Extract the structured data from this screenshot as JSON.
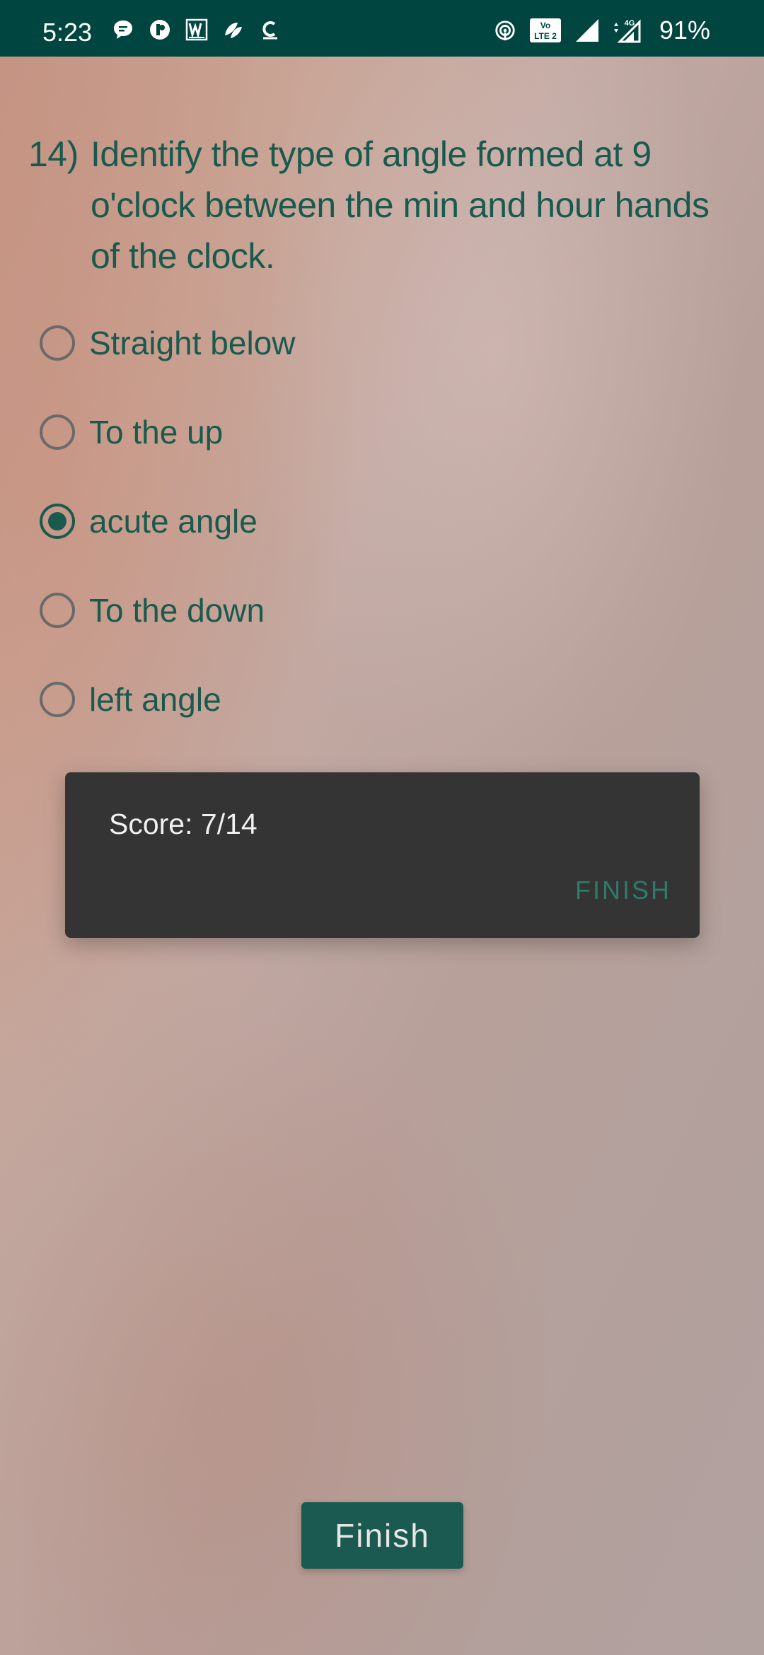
{
  "status_bar": {
    "time": "5:23",
    "battery": "91%",
    "network_badge": "4G",
    "volte_label": "Vo LTE 2",
    "left_icons": [
      "chat-bubble-icon",
      "app-circle-icon",
      "w-app-icon",
      "leaf-app-icon",
      "c-app-icon"
    ],
    "right_icons": [
      "hotspot-icon",
      "volte-icon",
      "signal-icon",
      "signal-4g-icon"
    ]
  },
  "question": {
    "number": "14)",
    "text": "Identify the type of angle formed at 9 o'clock between the min and hour hands of the clock."
  },
  "options": [
    {
      "label": "Straight below",
      "selected": false
    },
    {
      "label": "To the up",
      "selected": false
    },
    {
      "label": "acute angle",
      "selected": true
    },
    {
      "label": "To the down",
      "selected": false
    },
    {
      "label": "left angle",
      "selected": false
    }
  ],
  "dialog": {
    "message": "Score: 7/14",
    "button_label": "FINISH"
  },
  "finish_button": {
    "label": "Finish"
  },
  "colors": {
    "status_bar": "#004540",
    "accent": "#1a5a4e",
    "dialog_bg": "#343434",
    "dialog_button": "#2f7a6b"
  }
}
